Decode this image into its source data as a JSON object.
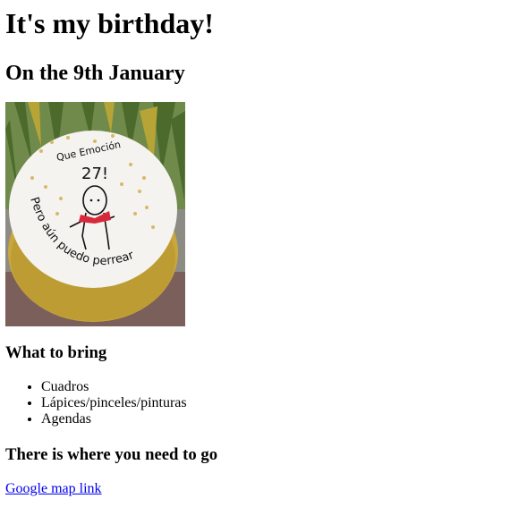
{
  "page": {
    "title": "It's my birthday!",
    "subtitle": "On the 9th January"
  },
  "cake_image": {
    "icon": "birthday-cake-photo",
    "inscription_top": "Que Emoción",
    "inscription_number": "27!",
    "inscription_bottom": "Pero aún puedo perrear",
    "colors": {
      "frosting": "#f4f3ef",
      "base": "#c9a73c",
      "foliage": "#5d7a3a",
      "background": "#8c8c84"
    }
  },
  "bring_section": {
    "heading": "What to bring",
    "items": [
      "Cuadros",
      "Lápices/pinceles/pinturas",
      "Agendas"
    ]
  },
  "location_section": {
    "heading": "There is where you need to go",
    "link_label": "Google map link"
  }
}
